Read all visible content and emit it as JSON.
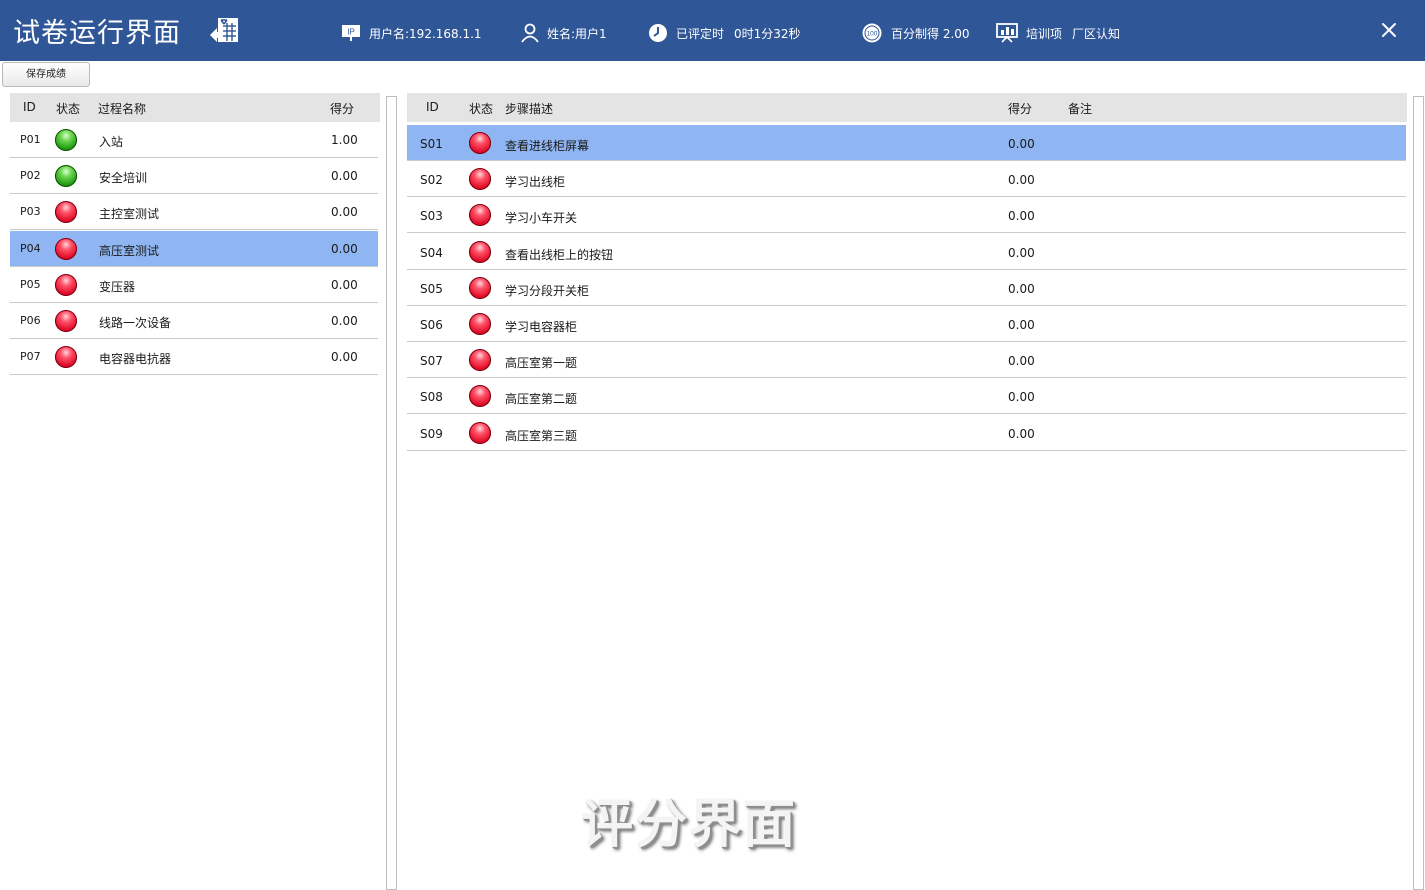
{
  "header": {
    "title": "试卷运行界面",
    "ip": "用户名:192.168.1.1",
    "name": "姓名:用户1",
    "elapsed_label": "已评定时",
    "elapsed_value": "0时1分32秒",
    "score_text": "百分制得 2.00",
    "training_label": "培训项",
    "training_value": "厂区认知",
    "score_icon_text": "100",
    "ip_icon_text": "IP"
  },
  "toolbar": {
    "save_label": "保存成绩"
  },
  "left_table": {
    "headers": {
      "id": "ID",
      "status": "状态",
      "name": "过程名称",
      "score": "得分"
    },
    "rows": [
      {
        "id": "P01",
        "status": "green",
        "name": "入站",
        "score": "1.00"
      },
      {
        "id": "P02",
        "status": "green",
        "name": "安全培训",
        "score": "0.00"
      },
      {
        "id": "P03",
        "status": "red",
        "name": "主控室测试",
        "score": "0.00"
      },
      {
        "id": "P04",
        "status": "red",
        "name": "高压室测试",
        "score": "0.00",
        "selected": true
      },
      {
        "id": "P05",
        "status": "red",
        "name": "变压器",
        "score": "0.00"
      },
      {
        "id": "P06",
        "status": "red",
        "name": "线路一次设备",
        "score": "0.00"
      },
      {
        "id": "P07",
        "status": "red",
        "name": "电容器电抗器",
        "score": "0.00"
      }
    ]
  },
  "right_table": {
    "headers": {
      "id": "ID",
      "status": "状态",
      "desc": "步骤描述",
      "score": "得分",
      "note": "备注"
    },
    "rows": [
      {
        "id": "S01",
        "status": "red",
        "desc": "查看进线柜屏幕",
        "score": "0.00",
        "note": "",
        "selected": true
      },
      {
        "id": "S02",
        "status": "red",
        "desc": "学习出线柜",
        "score": "0.00",
        "note": ""
      },
      {
        "id": "S03",
        "status": "red",
        "desc": "学习小车开关",
        "score": "0.00",
        "note": ""
      },
      {
        "id": "S04",
        "status": "red",
        "desc": "查看出线柜上的按钮",
        "score": "0.00",
        "note": ""
      },
      {
        "id": "S05",
        "status": "red",
        "desc": "学习分段开关柜",
        "score": "0.00",
        "note": ""
      },
      {
        "id": "S06",
        "status": "red",
        "desc": "学习电容器柜",
        "score": "0.00",
        "note": ""
      },
      {
        "id": "S07",
        "status": "red",
        "desc": "高压室第一题",
        "score": "0.00",
        "note": ""
      },
      {
        "id": "S08",
        "status": "red",
        "desc": "高压室第二题",
        "score": "0.00",
        "note": ""
      },
      {
        "id": "S09",
        "status": "red",
        "desc": "高压室第三题",
        "score": "0.00",
        "note": ""
      }
    ]
  },
  "watermark": "评分界面",
  "colors": {
    "header_bg": "#2f5697",
    "selected_row": "#8fb5f2",
    "table_header_bg": "#e4e4e4",
    "led_green": "#1e9a10",
    "led_red": "#df0a26"
  },
  "icons": {
    "title": "spreadsheet-export-icon",
    "ip": "ip-badge-icon",
    "name": "user-icon",
    "elapsed": "clock-icon",
    "score": "score-100-icon",
    "training": "presentation-chart-icon",
    "close": "close-icon"
  }
}
